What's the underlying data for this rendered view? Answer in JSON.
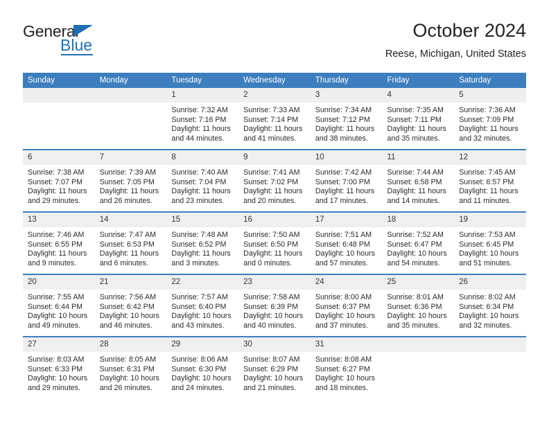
{
  "logo": {
    "word1": "General",
    "word2": "Blue",
    "triangle_color": "#1f6fb5",
    "text_color": "#231f20"
  },
  "header": {
    "title": "October 2024",
    "subtitle": "Reese, Michigan, United States"
  },
  "theme": {
    "header_blue": "#3d7ebe",
    "row_band_gray": "#efefef",
    "text": "#222222"
  },
  "weekdays": [
    "Sunday",
    "Monday",
    "Tuesday",
    "Wednesday",
    "Thursday",
    "Friday",
    "Saturday"
  ],
  "weeks": [
    [
      {
        "day": "",
        "blank": true,
        "sunrise": "",
        "sunset": "",
        "daylight1": "",
        "daylight2": ""
      },
      {
        "day": "",
        "blank": true,
        "sunrise": "",
        "sunset": "",
        "daylight1": "",
        "daylight2": ""
      },
      {
        "day": "1",
        "sunrise": "Sunrise: 7:32 AM",
        "sunset": "Sunset: 7:16 PM",
        "daylight1": "Daylight: 11 hours",
        "daylight2": "and 44 minutes."
      },
      {
        "day": "2",
        "sunrise": "Sunrise: 7:33 AM",
        "sunset": "Sunset: 7:14 PM",
        "daylight1": "Daylight: 11 hours",
        "daylight2": "and 41 minutes."
      },
      {
        "day": "3",
        "sunrise": "Sunrise: 7:34 AM",
        "sunset": "Sunset: 7:12 PM",
        "daylight1": "Daylight: 11 hours",
        "daylight2": "and 38 minutes."
      },
      {
        "day": "4",
        "sunrise": "Sunrise: 7:35 AM",
        "sunset": "Sunset: 7:11 PM",
        "daylight1": "Daylight: 11 hours",
        "daylight2": "and 35 minutes."
      },
      {
        "day": "5",
        "sunrise": "Sunrise: 7:36 AM",
        "sunset": "Sunset: 7:09 PM",
        "daylight1": "Daylight: 11 hours",
        "daylight2": "and 32 minutes."
      }
    ],
    [
      {
        "day": "6",
        "sunrise": "Sunrise: 7:38 AM",
        "sunset": "Sunset: 7:07 PM",
        "daylight1": "Daylight: 11 hours",
        "daylight2": "and 29 minutes."
      },
      {
        "day": "7",
        "sunrise": "Sunrise: 7:39 AM",
        "sunset": "Sunset: 7:05 PM",
        "daylight1": "Daylight: 11 hours",
        "daylight2": "and 26 minutes."
      },
      {
        "day": "8",
        "sunrise": "Sunrise: 7:40 AM",
        "sunset": "Sunset: 7:04 PM",
        "daylight1": "Daylight: 11 hours",
        "daylight2": "and 23 minutes."
      },
      {
        "day": "9",
        "sunrise": "Sunrise: 7:41 AM",
        "sunset": "Sunset: 7:02 PM",
        "daylight1": "Daylight: 11 hours",
        "daylight2": "and 20 minutes."
      },
      {
        "day": "10",
        "sunrise": "Sunrise: 7:42 AM",
        "sunset": "Sunset: 7:00 PM",
        "daylight1": "Daylight: 11 hours",
        "daylight2": "and 17 minutes."
      },
      {
        "day": "11",
        "sunrise": "Sunrise: 7:44 AM",
        "sunset": "Sunset: 6:58 PM",
        "daylight1": "Daylight: 11 hours",
        "daylight2": "and 14 minutes."
      },
      {
        "day": "12",
        "sunrise": "Sunrise: 7:45 AM",
        "sunset": "Sunset: 6:57 PM",
        "daylight1": "Daylight: 11 hours",
        "daylight2": "and 11 minutes."
      }
    ],
    [
      {
        "day": "13",
        "sunrise": "Sunrise: 7:46 AM",
        "sunset": "Sunset: 6:55 PM",
        "daylight1": "Daylight: 11 hours",
        "daylight2": "and 9 minutes."
      },
      {
        "day": "14",
        "sunrise": "Sunrise: 7:47 AM",
        "sunset": "Sunset: 6:53 PM",
        "daylight1": "Daylight: 11 hours",
        "daylight2": "and 6 minutes."
      },
      {
        "day": "15",
        "sunrise": "Sunrise: 7:48 AM",
        "sunset": "Sunset: 6:52 PM",
        "daylight1": "Daylight: 11 hours",
        "daylight2": "and 3 minutes."
      },
      {
        "day": "16",
        "sunrise": "Sunrise: 7:50 AM",
        "sunset": "Sunset: 6:50 PM",
        "daylight1": "Daylight: 11 hours",
        "daylight2": "and 0 minutes."
      },
      {
        "day": "17",
        "sunrise": "Sunrise: 7:51 AM",
        "sunset": "Sunset: 6:48 PM",
        "daylight1": "Daylight: 10 hours",
        "daylight2": "and 57 minutes."
      },
      {
        "day": "18",
        "sunrise": "Sunrise: 7:52 AM",
        "sunset": "Sunset: 6:47 PM",
        "daylight1": "Daylight: 10 hours",
        "daylight2": "and 54 minutes."
      },
      {
        "day": "19",
        "sunrise": "Sunrise: 7:53 AM",
        "sunset": "Sunset: 6:45 PM",
        "daylight1": "Daylight: 10 hours",
        "daylight2": "and 51 minutes."
      }
    ],
    [
      {
        "day": "20",
        "sunrise": "Sunrise: 7:55 AM",
        "sunset": "Sunset: 6:44 PM",
        "daylight1": "Daylight: 10 hours",
        "daylight2": "and 49 minutes."
      },
      {
        "day": "21",
        "sunrise": "Sunrise: 7:56 AM",
        "sunset": "Sunset: 6:42 PM",
        "daylight1": "Daylight: 10 hours",
        "daylight2": "and 46 minutes."
      },
      {
        "day": "22",
        "sunrise": "Sunrise: 7:57 AM",
        "sunset": "Sunset: 6:40 PM",
        "daylight1": "Daylight: 10 hours",
        "daylight2": "and 43 minutes."
      },
      {
        "day": "23",
        "sunrise": "Sunrise: 7:58 AM",
        "sunset": "Sunset: 6:39 PM",
        "daylight1": "Daylight: 10 hours",
        "daylight2": "and 40 minutes."
      },
      {
        "day": "24",
        "sunrise": "Sunrise: 8:00 AM",
        "sunset": "Sunset: 6:37 PM",
        "daylight1": "Daylight: 10 hours",
        "daylight2": "and 37 minutes."
      },
      {
        "day": "25",
        "sunrise": "Sunrise: 8:01 AM",
        "sunset": "Sunset: 6:36 PM",
        "daylight1": "Daylight: 10 hours",
        "daylight2": "and 35 minutes."
      },
      {
        "day": "26",
        "sunrise": "Sunrise: 8:02 AM",
        "sunset": "Sunset: 6:34 PM",
        "daylight1": "Daylight: 10 hours",
        "daylight2": "and 32 minutes."
      }
    ],
    [
      {
        "day": "27",
        "sunrise": "Sunrise: 8:03 AM",
        "sunset": "Sunset: 6:33 PM",
        "daylight1": "Daylight: 10 hours",
        "daylight2": "and 29 minutes."
      },
      {
        "day": "28",
        "sunrise": "Sunrise: 8:05 AM",
        "sunset": "Sunset: 6:31 PM",
        "daylight1": "Daylight: 10 hours",
        "daylight2": "and 26 minutes."
      },
      {
        "day": "29",
        "sunrise": "Sunrise: 8:06 AM",
        "sunset": "Sunset: 6:30 PM",
        "daylight1": "Daylight: 10 hours",
        "daylight2": "and 24 minutes."
      },
      {
        "day": "30",
        "sunrise": "Sunrise: 8:07 AM",
        "sunset": "Sunset: 6:29 PM",
        "daylight1": "Daylight: 10 hours",
        "daylight2": "and 21 minutes."
      },
      {
        "day": "31",
        "sunrise": "Sunrise: 8:08 AM",
        "sunset": "Sunset: 6:27 PM",
        "daylight1": "Daylight: 10 hours",
        "daylight2": "and 18 minutes."
      },
      {
        "day": "",
        "blank": true,
        "sunrise": "",
        "sunset": "",
        "daylight1": "",
        "daylight2": ""
      },
      {
        "day": "",
        "blank": true,
        "sunrise": "",
        "sunset": "",
        "daylight1": "",
        "daylight2": ""
      }
    ]
  ]
}
